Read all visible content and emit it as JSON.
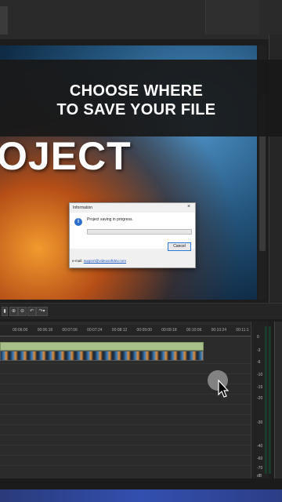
{
  "banner": {
    "line1": "CHOOSE WHERE",
    "line2": "TO SAVE YOUR FILE"
  },
  "preview": {
    "overlay_text": "OJECT"
  },
  "dialog": {
    "title": "Information",
    "close": "×",
    "message": "Project saving in progress.",
    "progress": 0,
    "cancel_label": "Cancel",
    "email_label": "e-mail:",
    "email_address": "support@videosoftdev.com"
  },
  "toolbar": {
    "icons": [
      "timeline-view-icon",
      "zoom-in-icon",
      "zoom-out-icon",
      "undo-icon",
      "redo-dropdown-icon"
    ]
  },
  "timeline": {
    "ticks": [
      "00:06:00",
      "00:06:18",
      "00:07:06",
      "00:07:24",
      "00:08:12",
      "00:09:00",
      "00:09:18",
      "00:10:06",
      "00:10:24",
      "00:11:1"
    ]
  },
  "meter": {
    "labels": [
      "0",
      "-3",
      "-6",
      "-10",
      "-15",
      "-20",
      "-30",
      "-40",
      "-60",
      "-70",
      "dB"
    ]
  },
  "colors": {
    "accent": "#2b6fcb",
    "green_track": "#a8bf8a"
  }
}
